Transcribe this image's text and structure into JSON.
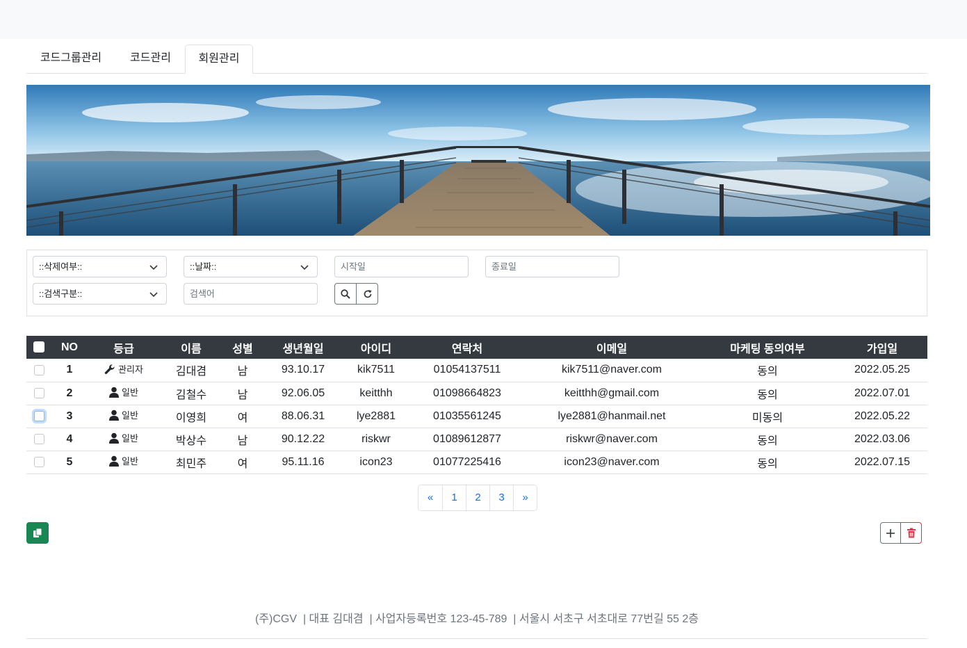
{
  "tabs": [
    {
      "label": "코드그룹관리"
    },
    {
      "label": "코드관리"
    },
    {
      "label": "회원관리"
    }
  ],
  "active_tab": "회원관리",
  "search": {
    "delete_select": "::삭제여부::",
    "date_select": "::날짜::",
    "start_placeholder": "시작일",
    "end_placeholder": "종료일",
    "type_select": "::검색구분::",
    "keyword_placeholder": "검색어"
  },
  "table": {
    "headers": [
      "NO",
      "등급",
      "이름",
      "성별",
      "생년월일",
      "아이디",
      "연락처",
      "이메일",
      "마케팅 동의여부",
      "가입일"
    ],
    "rows": [
      {
        "no": "1",
        "grade": "관리자",
        "grade_icon": "wrench-icon",
        "name": "김대겸",
        "gender": "남",
        "birth": "93.10.17",
        "id": "kik7511",
        "phone": "01054137511",
        "email": "kik7511@naver.com",
        "marketing": "동의",
        "joined": "2022.05.25"
      },
      {
        "no": "2",
        "grade": "일반",
        "grade_icon": "user-icon",
        "name": "김철수",
        "gender": "남",
        "birth": "92.06.05",
        "id": "keitthh",
        "phone": "01098664823",
        "email": "keitthh@gmail.com",
        "marketing": "동의",
        "joined": "2022.07.01"
      },
      {
        "no": "3",
        "grade": "일반",
        "grade_icon": "user-icon",
        "name": "이영희",
        "gender": "여",
        "birth": "88.06.31",
        "id": "lye2881",
        "phone": "01035561245",
        "email": "lye2881@hanmail.net",
        "marketing": "미동의",
        "joined": "2022.05.22"
      },
      {
        "no": "4",
        "grade": "일반",
        "grade_icon": "user-icon",
        "name": "박상수",
        "gender": "남",
        "birth": "90.12.22",
        "id": "riskwr",
        "phone": "01089612877",
        "email": "riskwr@naver.com",
        "marketing": "동의",
        "joined": "2022.03.06"
      },
      {
        "no": "5",
        "grade": "일반",
        "grade_icon": "user-icon",
        "name": "최민주",
        "gender": "여",
        "birth": "95.11.16",
        "id": "icon23",
        "phone": "01077225416",
        "email": "icon23@naver.com",
        "marketing": "동의",
        "joined": "2022.07.15"
      }
    ]
  },
  "pagination": {
    "prev": "«",
    "pages": [
      "1",
      "2",
      "3"
    ],
    "next": "»"
  },
  "colors": {
    "header_bg": "#343a40",
    "link": "#0d6efd",
    "copy_button": "#198754",
    "delete_button": "#dc3545"
  },
  "footer": {
    "text": "(주)CGV  | 대표 김대겸  | 사업자등록번호 123-45-789  | 서울시 서초구 서초대로 77번길 55 2층"
  }
}
